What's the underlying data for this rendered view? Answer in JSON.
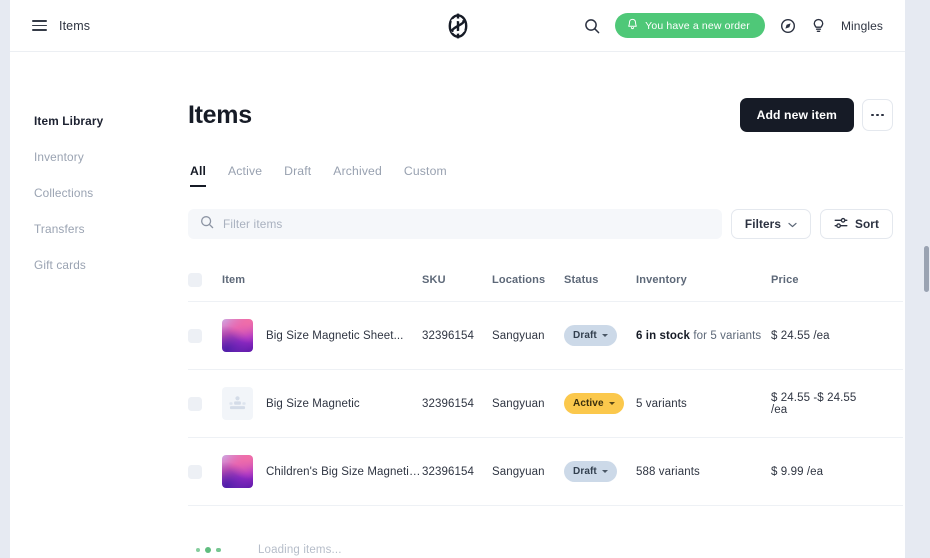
{
  "topbar": {
    "menu_icon": "hamburger-icon",
    "menu_label": "Items",
    "logo_icon": "brand-s-logo",
    "search_icon": "search-icon",
    "order_notice": "You have a new order",
    "bell_icon": "bell-icon",
    "compass_icon": "compass-icon",
    "bulb_icon": "lightbulb-icon",
    "user_name": "Mingles"
  },
  "sidebar": {
    "items": [
      {
        "label": "Item Library",
        "active": true
      },
      {
        "label": "Inventory",
        "active": false
      },
      {
        "label": "Collections",
        "active": false
      },
      {
        "label": "Transfers",
        "active": false
      },
      {
        "label": "Gift cards",
        "active": false
      }
    ]
  },
  "page": {
    "title": "Items",
    "add_button": "Add new item",
    "more_button": "more-options"
  },
  "tabs": [
    {
      "label": "All",
      "active": true
    },
    {
      "label": "Active",
      "active": false
    },
    {
      "label": "Draft",
      "active": false
    },
    {
      "label": "Archived",
      "active": false
    },
    {
      "label": "Custom",
      "active": false
    }
  ],
  "search": {
    "placeholder": "Filter items",
    "value": "",
    "icon": "search-icon"
  },
  "filters_button": {
    "label": "Filters",
    "icon": "chevron-down-icon"
  },
  "sort_button": {
    "label": "Sort",
    "icon": "sort-sliders-icon"
  },
  "table": {
    "columns": [
      "Item",
      "SKU",
      "Locations",
      "Status",
      "Inventory",
      "Price"
    ],
    "add_column_icon": "plus-circle-icon",
    "rows": [
      {
        "thumb": "gradient",
        "name": "Big Size Magnetic Sheet...",
        "sku": "32396154",
        "location": "Sangyuan",
        "status": "Draft",
        "status_kind": "draft",
        "inventory_strong": "6 in stock",
        "inventory_rest": " for 5 variants",
        "price": "$ 24.55 /ea"
      },
      {
        "thumb": "placeholder",
        "name": "Big Size Magnetic",
        "sku": "32396154",
        "location": "Sangyuan",
        "status": "Active",
        "status_kind": "active",
        "inventory_strong": "",
        "inventory_rest": "5 variants",
        "price": "$ 24.55 -$ 24.55 /ea"
      },
      {
        "thumb": "gradient",
        "name": "Children's Big Size Magnetic She...",
        "sku": "32396154",
        "location": "Sangyuan",
        "status": "Draft",
        "status_kind": "draft",
        "inventory_strong": "",
        "inventory_rest": "588 variants",
        "price": "$ 9.99 /ea"
      }
    ]
  },
  "loading": {
    "text": "Loading items..."
  },
  "colors": {
    "accent_green": "#4fc878",
    "dark": "#161b26",
    "badge_draft": "#ccd9e8",
    "badge_active": "#fbc84c",
    "page_bg": "#e6eaf2"
  }
}
